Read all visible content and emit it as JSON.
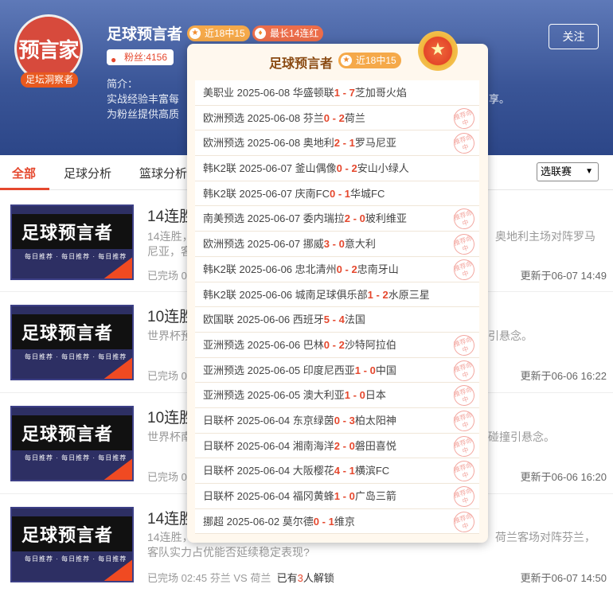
{
  "profile": {
    "avatar_text": "预言家",
    "avatar_tag": "足坛洞察者",
    "name": "足球预言者",
    "badge_recent": "近18中15",
    "badge_streak": "最长14连红",
    "fans": "粉丝:4156",
    "follow_label": "关注",
    "intro_label": "简介：",
    "intro_line1": "实战经验丰富每",
    "intro_line1_tail": "享。",
    "intro_line2": "为粉丝提供高质"
  },
  "tabs": [
    {
      "label": "全部"
    },
    {
      "label": "足球分析"
    },
    {
      "label": "篮球分析"
    }
  ],
  "filter": {
    "selected": "选联赛"
  },
  "list": [
    {
      "title": "14连胜",
      "thumb_title": "足球预言者",
      "thumb_sub": "每日推荐 · 每日推荐 · 每日推荐",
      "desc1": "14连胜，",
      "desc1_tail": "奥地利主场对阵罗马",
      "desc2": "尼亚，客",
      "meta": "已完场 0",
      "time": "更新于06-07 14:49"
    },
    {
      "title": "10连胜",
      "thumb_title": "足球预言者",
      "thumb_sub": "每日推荐 · 每日推荐 · 每日推荐",
      "desc1": "世界杯预",
      "desc1_tail": "引悬念。",
      "desc2": "",
      "meta": "已完场 0",
      "time": "更新于06-06 16:22"
    },
    {
      "title": "10连胜",
      "thumb_title": "足球预言者",
      "thumb_sub": "每日推荐 · 每日推荐 · 每日推荐",
      "desc1": "世界杯南",
      "desc1_tail": "碰撞引悬念。",
      "desc2": "",
      "meta": "已完场 0",
      "time": "更新于06-06 16:20"
    },
    {
      "title": "14连胜",
      "thumb_title": "足球预言者",
      "thumb_sub": "每日推荐 · 每日推荐 · 每日推荐",
      "desc1": "14连胜，",
      "desc1_tail": "荷兰客场对阵芬兰，",
      "desc2": "客队实力占优能否延续稳定表现?",
      "meta_prefix": "已完场 02:45 芬兰 VS 荷兰",
      "meta_count_pre": "已有",
      "meta_count": "3",
      "meta_count_post": "人解锁",
      "time": "更新于06-07 14:50"
    }
  ],
  "popup": {
    "title": "足球预言者",
    "badge": "近18中15",
    "stamp_text": "推荐命中",
    "records": [
      {
        "league": "美职业",
        "date": "2025-06-08",
        "home": "华盛顿联",
        "hs": "1",
        "as": "7",
        "away": "芝加哥火焰",
        "hit": false
      },
      {
        "league": "欧洲预选",
        "date": "2025-06-08",
        "home": "芬兰",
        "hs": "0",
        "as": "2",
        "away": "荷兰",
        "hit": true
      },
      {
        "league": "欧洲预选",
        "date": "2025-06-08",
        "home": "奥地利",
        "hs": "2",
        "as": "1",
        "away": "罗马尼亚",
        "hit": true
      },
      {
        "league": "韩K2联",
        "date": "2025-06-07",
        "home": "釜山偶像",
        "hs": "0",
        "as": "2",
        "away": "安山小绿人",
        "hit": false
      },
      {
        "league": "韩K2联",
        "date": "2025-06-07",
        "home": "庆南FC",
        "hs": "0",
        "as": "1",
        "away": "华城FC",
        "hit": false
      },
      {
        "league": "南美预选",
        "date": "2025-06-07",
        "home": "委内瑞拉",
        "hs": "2",
        "as": "0",
        "away": "玻利维亚",
        "hit": true
      },
      {
        "league": "欧洲预选",
        "date": "2025-06-07",
        "home": "挪威",
        "hs": "3",
        "as": "0",
        "away": "意大利",
        "hit": true
      },
      {
        "league": "韩K2联",
        "date": "2025-06-06",
        "home": "忠北清州",
        "hs": "0",
        "as": "2",
        "away": "忠南牙山",
        "hit": true
      },
      {
        "league": "韩K2联",
        "date": "2025-06-06",
        "home": "城南足球俱乐部",
        "hs": "1",
        "as": "2",
        "away": "水原三星",
        "hit": false
      },
      {
        "league": "欧国联",
        "date": "2025-06-06",
        "home": "西班牙",
        "hs": "5",
        "as": "4",
        "away": "法国",
        "hit": false
      },
      {
        "league": "亚洲预选",
        "date": "2025-06-06",
        "home": "巴林",
        "hs": "0",
        "as": "2",
        "away": "沙特阿拉伯",
        "hit": true
      },
      {
        "league": "亚洲预选",
        "date": "2025-06-05",
        "home": "印度尼西亚",
        "hs": "1",
        "as": "0",
        "away": "中国",
        "hit": true
      },
      {
        "league": "亚洲预选",
        "date": "2025-06-05",
        "home": "澳大利亚",
        "hs": "1",
        "as": "0",
        "away": "日本",
        "hit": true
      },
      {
        "league": "日联杯",
        "date": "2025-06-04",
        "home": "东京绿茵",
        "hs": "0",
        "as": "3",
        "away": "柏太阳神",
        "hit": true
      },
      {
        "league": "日联杯",
        "date": "2025-06-04",
        "home": "湘南海洋",
        "hs": "2",
        "as": "0",
        "away": "磐田喜悦",
        "hit": true
      },
      {
        "league": "日联杯",
        "date": "2025-06-04",
        "home": "大阪樱花",
        "hs": "4",
        "as": "1",
        "away": "横滨FC",
        "hit": true
      },
      {
        "league": "日联杯",
        "date": "2025-06-04",
        "home": "福冈黄蜂",
        "hs": "1",
        "as": "0",
        "away": "广岛三箭",
        "hit": true
      },
      {
        "league": "挪超",
        "date": "2025-06-02",
        "home": "莫尔德",
        "hs": "0",
        "as": "1",
        "away": "维京",
        "hit": true
      }
    ]
  }
}
